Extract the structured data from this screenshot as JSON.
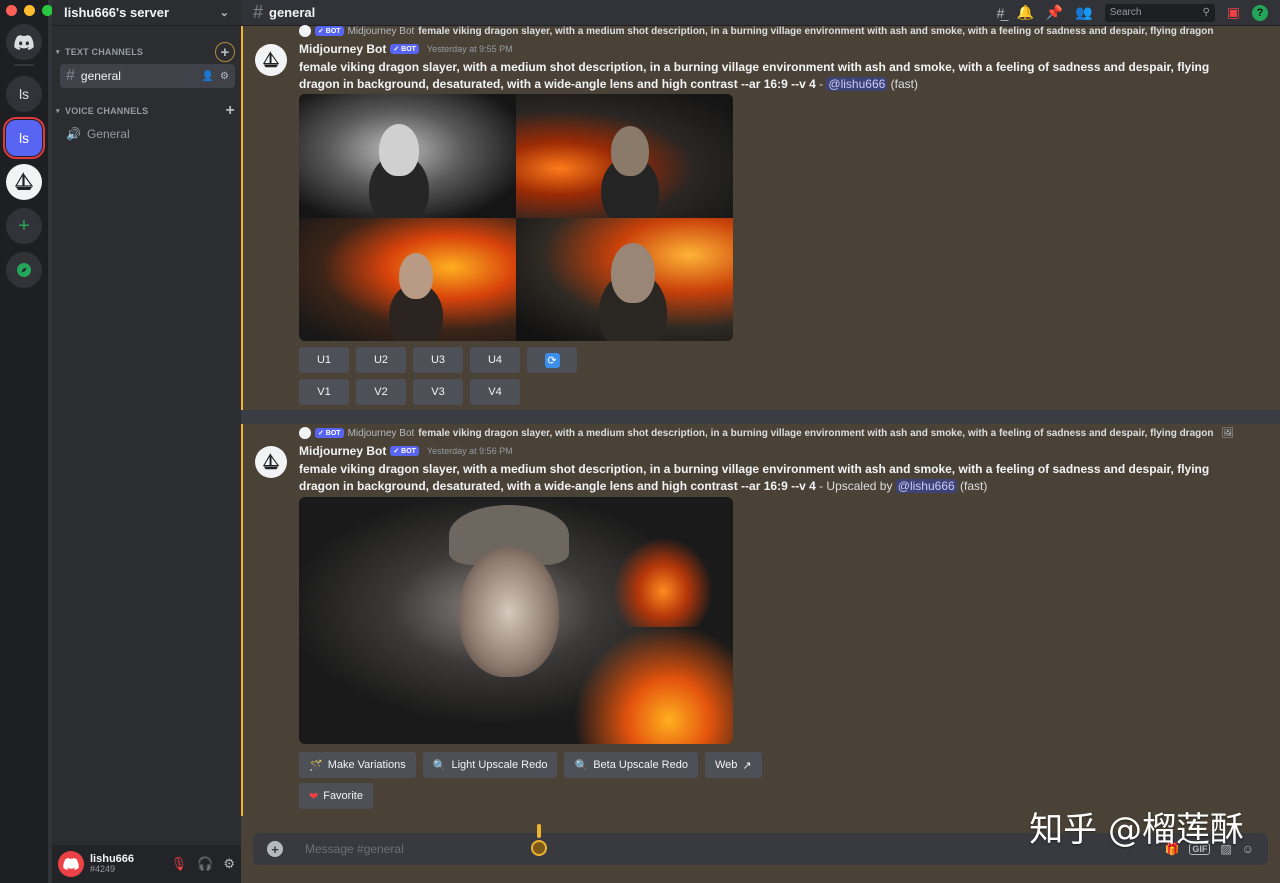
{
  "window": {
    "traffic_colors": [
      "#ff5f57",
      "#febc2e",
      "#28c840"
    ]
  },
  "servers": [
    {
      "label": "",
      "icon": "discord-icon"
    },
    {
      "label": "ls"
    },
    {
      "label": "ls"
    },
    {
      "label": "",
      "icon": "sailboat-icon"
    },
    {
      "label": "+",
      "icon": "add-server-icon"
    },
    {
      "label": "",
      "icon": "compass-icon"
    }
  ],
  "sidebar": {
    "server_name": "lishu666's server",
    "text_category": "TEXT CHANNELS",
    "voice_category": "VOICE CHANNELS",
    "text_channels": [
      {
        "name": "general"
      }
    ],
    "voice_channels": [
      {
        "name": "General"
      }
    ],
    "user": {
      "name": "lishu666",
      "tag": "#4249"
    }
  },
  "header": {
    "channel": "general",
    "search_placeholder": "Search"
  },
  "messages": [
    {
      "reply_author": "Midjourney Bot",
      "reply_snippet": "female viking dragon slayer, with a medium shot description, in a burning village environment with ash and smoke, with a feeling of sadness and despair, flying dragon",
      "author": "Midjourney Bot",
      "badge": "✓ BOT",
      "timestamp": "Yesterday at 9:55 PM",
      "prompt": "female viking dragon slayer, with a medium shot description, in a burning village environment with ash and smoke, with a feeling of sadness and despair, flying dragon in background, desaturated, with a wide-angle lens and high contrast --ar 16:9 --v 4",
      "sep": " - ",
      "mention": "@lishu666",
      "suffix": " (fast)",
      "buttons_row1": [
        "U1",
        "U2",
        "U3",
        "U4"
      ],
      "buttons_row2": [
        "V1",
        "V2",
        "V3",
        "V4"
      ],
      "refresh_icon": "🔄"
    },
    {
      "reply_author": "Midjourney Bot",
      "reply_snippet": "female viking dragon slayer, with a medium shot description, in a burning village environment with ash and smoke, with a feeling of sadness and despair, flying dragon",
      "author": "Midjourney Bot",
      "badge": "✓ BOT",
      "timestamp": "Yesterday at 9:56 PM",
      "prompt": "female viking dragon slayer, with a medium shot description, in a burning village environment with ash and smoke, with a feeling of sadness and despair, flying dragon in background, desaturated, with a wide-angle lens and high contrast --ar 16:9 --v 4",
      "sep": " - Upscaled by ",
      "mention": "@lishu666",
      "suffix": " (fast)",
      "actions": [
        {
          "label": "Make Variations",
          "icon": "🪄"
        },
        {
          "label": "Light Upscale Redo",
          "icon": "🔍"
        },
        {
          "label": "Beta Upscale Redo",
          "icon": "🔍"
        },
        {
          "label": "Web",
          "icon": "↗"
        }
      ],
      "favorite": {
        "label": "Favorite",
        "icon": "❤"
      }
    }
  ],
  "composer": {
    "placeholder": "Message #general"
  },
  "watermark": "知乎 @榴莲酥",
  "accent_color": "#f0b232",
  "blurple": "#5865f2"
}
